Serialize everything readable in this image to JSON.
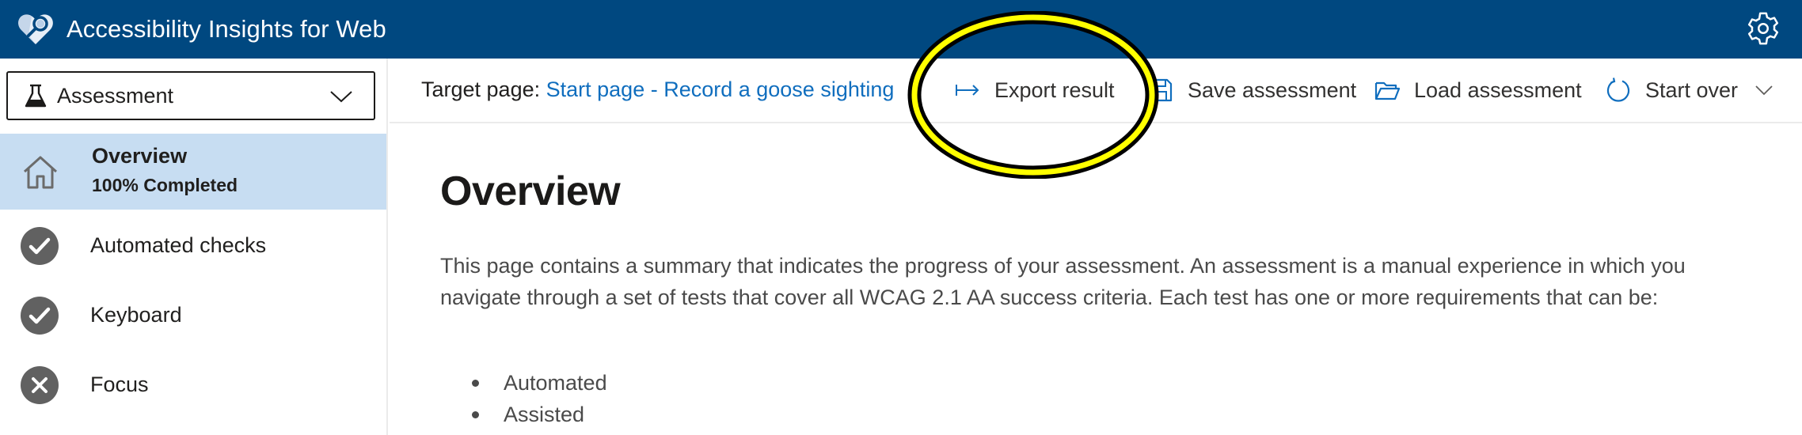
{
  "header": {
    "app_title": "Accessibility Insights for Web",
    "logo_icon": "heart-magnifier-logo",
    "settings_icon": "gear-icon"
  },
  "sidebar": {
    "mode_selector": {
      "value": "Assessment",
      "icon": "flask-icon"
    },
    "overview": {
      "label": "Overview",
      "status": "100% Completed",
      "icon": "home-icon",
      "selected": true
    },
    "tests": [
      {
        "label": "Automated checks",
        "status": "pass",
        "icon": "check-circle-icon"
      },
      {
        "label": "Keyboard",
        "status": "pass",
        "icon": "check-circle-icon"
      },
      {
        "label": "Focus",
        "status": "fail",
        "icon": "x-circle-icon"
      }
    ]
  },
  "command_bar": {
    "target_label": "Target page:",
    "target_link": "Start page - Record a goose sighting",
    "export_label": "Export result",
    "save_label": "Save assessment",
    "load_label": "Load assessment",
    "start_over_label": "Start over"
  },
  "main": {
    "title": "Overview",
    "description": "This page contains a summary that indicates the progress of your assessment. An assessment is a manual experience in which you navigate through a set of tests that cover all WCAG 2.1 AA success criteria. Each test has one or more requirements that can be:",
    "requirement_types": [
      "Automated",
      "Assisted"
    ]
  },
  "annotation": {
    "highlighted_element": "Export result"
  },
  "colors": {
    "header_bg": "#004880",
    "selected_nav_bg": "#c7ddf2",
    "link": "#106ebe",
    "status_icon": "#616161",
    "highlight_ring": "#ffff00"
  }
}
